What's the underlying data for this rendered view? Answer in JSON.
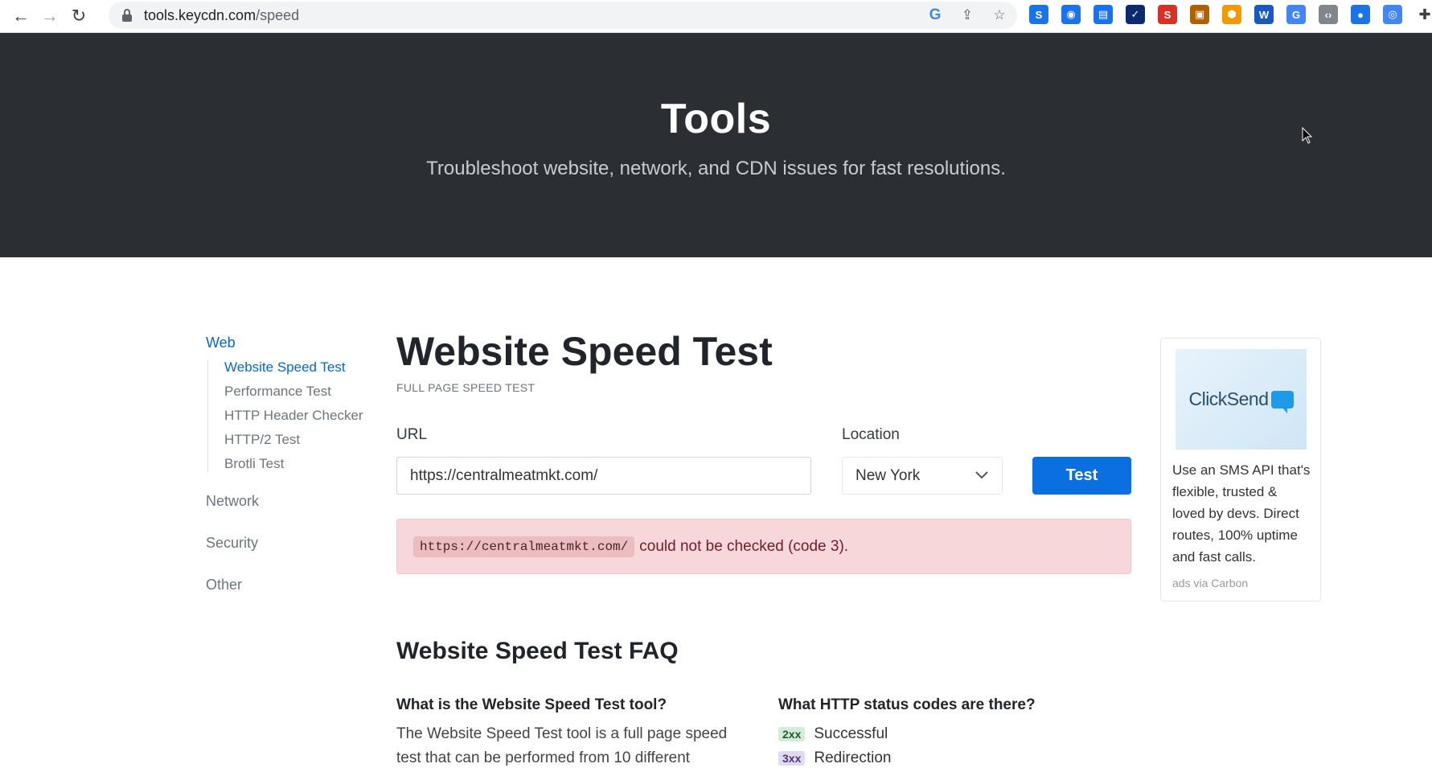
{
  "browser": {
    "url_host": "tools.keycdn.com",
    "url_path": "/speed",
    "extensions": [
      {
        "name": "ext-s-icon",
        "color": "#1a73e8",
        "glyph": "S"
      },
      {
        "name": "ext-camera-icon",
        "color": "#1a73e8",
        "glyph": "◉"
      },
      {
        "name": "ext-reader-icon",
        "color": "#1a73e8",
        "glyph": "▤"
      },
      {
        "name": "ext-check-icon",
        "color": "#0b2a6f",
        "glyph": "✓"
      },
      {
        "name": "ext-seo-icon",
        "color": "#d93025",
        "glyph": "S"
      },
      {
        "name": "ext-window-icon",
        "color": "#b06000",
        "glyph": "▣"
      },
      {
        "name": "ext-hex-icon",
        "color": "#f29900",
        "glyph": "⬢"
      },
      {
        "name": "ext-word-icon",
        "color": "#185abd",
        "glyph": "W"
      },
      {
        "name": "ext-translate-icon",
        "color": "#4285f4",
        "glyph": "G"
      },
      {
        "name": "ext-code-icon",
        "color": "#80868b",
        "glyph": "‹›"
      },
      {
        "name": "ext-circle-icon",
        "color": "#1a73e8",
        "glyph": "●"
      },
      {
        "name": "ext-ring-icon",
        "color": "#4285f4",
        "glyph": "◎"
      },
      {
        "name": "extensions-puzzle-icon",
        "color": "#3c4043",
        "glyph": "✚"
      }
    ]
  },
  "hero": {
    "title": "Tools",
    "subtitle": "Troubleshoot website, network, and CDN issues for fast resolutions."
  },
  "sidebar": {
    "web": "Web",
    "web_links": [
      "Website Speed Test",
      "Performance Test",
      "HTTP Header Checker",
      "HTTP/2 Test",
      "Brotli Test"
    ],
    "network": "Network",
    "security": "Security",
    "other": "Other"
  },
  "main": {
    "title": "Website Speed Test",
    "subtitle": "FULL PAGE SPEED TEST",
    "url_label": "URL",
    "url_value": "https://centralmeatmkt.com/",
    "location_label": "Location",
    "location_value": "New York",
    "test_button": "Test",
    "alert_code": "https://centralmeatmkt.com/",
    "alert_text": "could not be checked (code 3).",
    "faq_title": "Website Speed Test FAQ",
    "faq_q1": "What is the Website Speed Test tool?",
    "faq_a1": "The Website Speed Test tool is a full page speed test that can be performed from 10 different",
    "faq_q2": "What HTTP status codes are there?",
    "status_codes": [
      {
        "code": "2xx",
        "label": "Successful",
        "color": "#d4edda"
      },
      {
        "code": "3xx",
        "label": "Redirection",
        "color": "#e2d9f3"
      }
    ]
  },
  "ad": {
    "logo": "ClickSend",
    "text": "Use an SMS API that's flexible, trusted & loved by devs. Direct routes, 100% uptime and fast calls.",
    "via": "ads via Carbon"
  }
}
